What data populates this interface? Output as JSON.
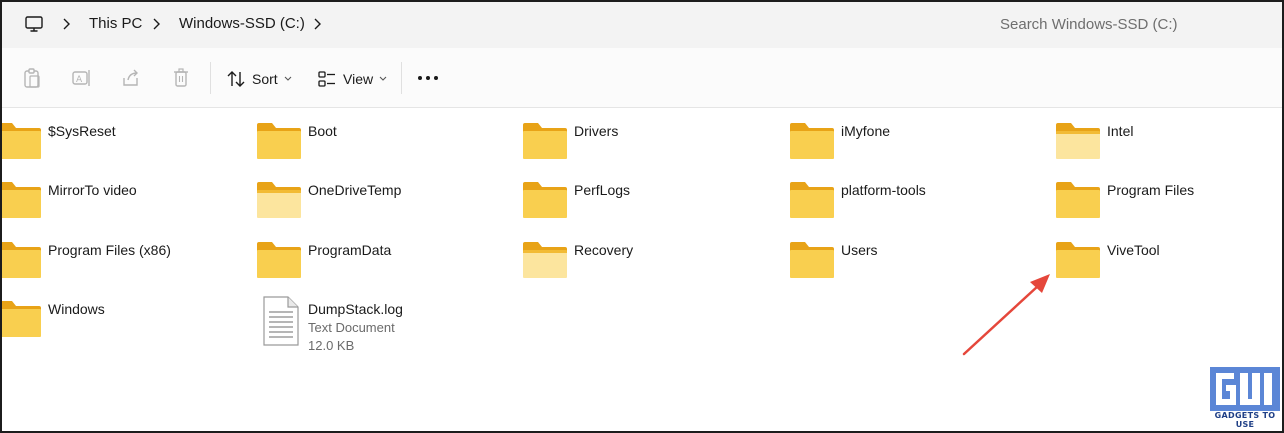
{
  "breadcrumb": {
    "root_icon": "computer-icon",
    "items": [
      "This PC",
      "Windows-SSD (C:)"
    ]
  },
  "search": {
    "placeholder": "Search Windows-SSD (C:)"
  },
  "toolbar": {
    "icons": [
      "paste-icon",
      "rename-icon",
      "share-icon",
      "delete-icon"
    ],
    "sort_label": "Sort",
    "view_label": "View",
    "more_icon": "more-options-icon"
  },
  "items": [
    {
      "name": "$SysReset",
      "kind": "folder"
    },
    {
      "name": "Boot",
      "kind": "folder"
    },
    {
      "name": "Drivers",
      "kind": "folder"
    },
    {
      "name": "iMyfone",
      "kind": "folder"
    },
    {
      "name": "Intel",
      "kind": "folder"
    },
    {
      "name": "MirrorTo video",
      "kind": "folder"
    },
    {
      "name": "OneDriveTemp",
      "kind": "folder"
    },
    {
      "name": "PerfLogs",
      "kind": "folder"
    },
    {
      "name": "platform-tools",
      "kind": "folder"
    },
    {
      "name": "Program Files",
      "kind": "folder"
    },
    {
      "name": "Program Files (x86)",
      "kind": "folder"
    },
    {
      "name": "ProgramData",
      "kind": "folder"
    },
    {
      "name": "Recovery",
      "kind": "folder"
    },
    {
      "name": "Users",
      "kind": "folder"
    },
    {
      "name": "ViveTool",
      "kind": "folder"
    },
    {
      "name": "Windows",
      "kind": "folder"
    },
    {
      "name": "DumpStack.log",
      "kind": "file",
      "type": "Text Document",
      "size": "12.0 KB"
    }
  ],
  "annotation": {
    "arrow_color": "#e5473b",
    "target": "ViveTool"
  },
  "watermark": {
    "text": "GADGETS TO USE"
  },
  "colors": {
    "folder_front": "#f9cf4f",
    "folder_back": "#e8a317",
    "accent": "#0067c0"
  }
}
